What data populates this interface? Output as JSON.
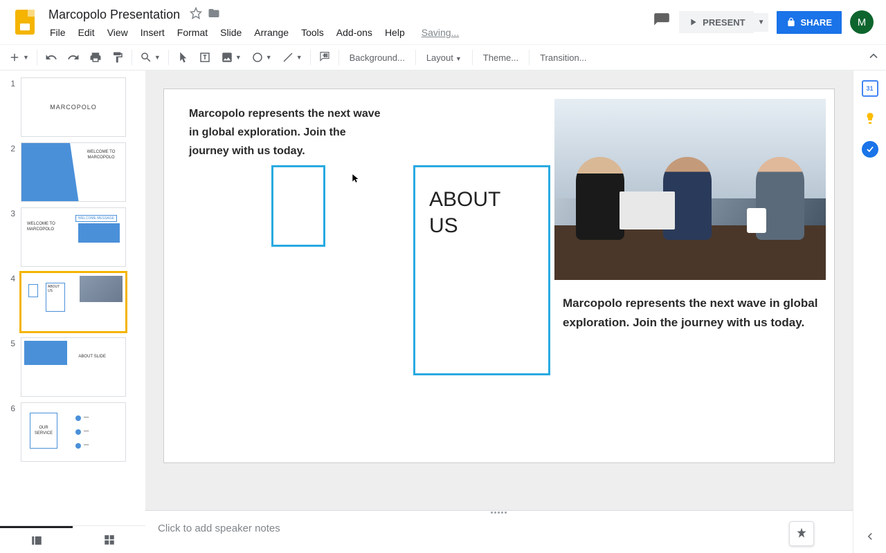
{
  "header": {
    "doc_title": "Marcopolo Presentation",
    "saving_label": "Saving...",
    "present_label": "PRESENT",
    "share_label": "SHARE",
    "avatar_letter": "M"
  },
  "menubar": {
    "file": "File",
    "edit": "Edit",
    "view": "View",
    "insert": "Insert",
    "format": "Format",
    "slide": "Slide",
    "arrange": "Arrange",
    "tools": "Tools",
    "addons": "Add-ons",
    "help": "Help"
  },
  "toolbar": {
    "background": "Background...",
    "layout": "Layout",
    "theme": "Theme...",
    "transition": "Transition..."
  },
  "right_rail": {
    "calendar_day": "31"
  },
  "filmstrip": {
    "slides": [
      {
        "num": "1",
        "title": "MARCOPOLO"
      },
      {
        "num": "2",
        "title": "WELCOME TO MARCOPOLO"
      },
      {
        "num": "3",
        "title": "WELCOME TO MARCOPOLO",
        "badge": "WELCOME MESSAGE"
      },
      {
        "num": "4",
        "title": "ABOUT US"
      },
      {
        "num": "5",
        "title": "ABOUT SLIDE"
      },
      {
        "num": "6",
        "title": "OUR SERVICE"
      }
    ]
  },
  "slide": {
    "left_text": "Marcopolo represents the next wave in global exploration. Join the journey with us today.",
    "box_heading": "ABOUT US",
    "right_text": "Marcopolo represents the next wave in global exploration. Join the journey with us today."
  },
  "notes": {
    "placeholder": "Click to add speaker notes"
  }
}
